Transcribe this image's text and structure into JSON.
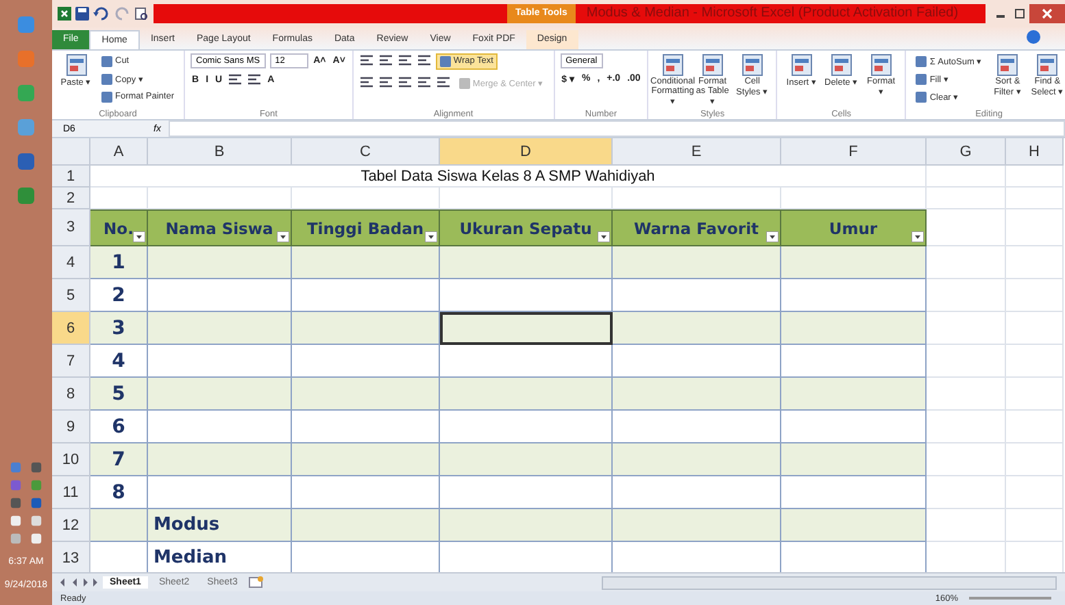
{
  "taskbar": {
    "time": "6:37 AM",
    "date": "9/24/2018"
  },
  "window": {
    "title": "Modus & Median  -  Microsoft Excel (Product Activation Failed)",
    "context_tab": "Table Tools"
  },
  "tabs": [
    {
      "label": "File",
      "kind": "file",
      "selected": false
    },
    {
      "label": "Home",
      "kind": "tab",
      "selected": true
    },
    {
      "label": "Insert",
      "kind": "tab",
      "selected": false
    },
    {
      "label": "Page Layout",
      "kind": "tab",
      "selected": false
    },
    {
      "label": "Formulas",
      "kind": "tab",
      "selected": false
    },
    {
      "label": "Data",
      "kind": "tab",
      "selected": false
    },
    {
      "label": "Review",
      "kind": "tab",
      "selected": false
    },
    {
      "label": "View",
      "kind": "tab",
      "selected": false
    },
    {
      "label": "Foxit PDF",
      "kind": "tab",
      "selected": false
    },
    {
      "label": "Design",
      "kind": "context",
      "selected": false
    }
  ],
  "ribbon": [
    {
      "name": "Clipboard",
      "lines": [
        [
          {
            "kind": "large",
            "label": "Paste ▾"
          }
        ],
        [
          {
            "kind": "small",
            "label": "Cut"
          },
          {
            "kind": "small",
            "label": "Copy ▾"
          },
          {
            "kind": "small",
            "label": "Format Painter"
          }
        ]
      ]
    },
    {
      "name": "Font",
      "lines": [
        [
          {
            "kind": "field",
            "label": "Comic Sans MS"
          },
          {
            "kind": "field",
            "label": "12"
          },
          {
            "kind": "glyph",
            "label": "A˄"
          },
          {
            "kind": "glyph",
            "label": "A˅"
          }
        ],
        [
          {
            "kind": "glyph",
            "label": "B"
          },
          {
            "kind": "glyph",
            "label": "I"
          },
          {
            "kind": "glyph",
            "label": "U"
          },
          {
            "kind": "icon"
          },
          {
            "kind": "icon"
          },
          {
            "kind": "glyph",
            "label": "A"
          }
        ]
      ]
    },
    {
      "name": "Alignment",
      "lines": [
        [
          {
            "kind": "icon"
          },
          {
            "kind": "icon"
          },
          {
            "kind": "icon"
          },
          {
            "kind": "icon"
          },
          {
            "kind": "small",
            "label": "Wrap Text",
            "on": true
          }
        ],
        [
          {
            "kind": "icon"
          },
          {
            "kind": "icon"
          },
          {
            "kind": "icon"
          },
          {
            "kind": "icon"
          },
          {
            "kind": "icon"
          },
          {
            "kind": "small",
            "label": "Merge & Center ▾",
            "disabled": true
          }
        ]
      ]
    },
    {
      "name": "Number",
      "lines": [
        [
          {
            "kind": "field",
            "label": "General"
          }
        ],
        [
          {
            "kind": "glyph",
            "label": "$ ▾"
          },
          {
            "kind": "glyph",
            "label": "%"
          },
          {
            "kind": "glyph",
            "label": ","
          },
          {
            "kind": "glyph",
            "label": "+.0"
          },
          {
            "kind": "glyph",
            "label": ".00"
          }
        ]
      ]
    },
    {
      "name": "Styles",
      "lines": [
        [
          {
            "kind": "large",
            "label": "Conditional Formatting ▾"
          }
        ],
        [
          {
            "kind": "large",
            "label": "Format as Table ▾"
          }
        ],
        [
          {
            "kind": "large",
            "label": "Cell Styles ▾"
          }
        ]
      ]
    },
    {
      "name": "Cells",
      "lines": [
        [
          {
            "kind": "large",
            "label": "Insert ▾"
          }
        ],
        [
          {
            "kind": "large",
            "label": "Delete ▾"
          }
        ],
        [
          {
            "kind": "large",
            "label": "Format ▾"
          }
        ]
      ]
    },
    {
      "name": "Editing",
      "lines": [
        [
          {
            "kind": "small",
            "label": "Σ AutoSum ▾"
          },
          {
            "kind": "small",
            "label": "Fill ▾"
          },
          {
            "kind": "small",
            "label": "Clear ▾"
          }
        ],
        [
          {
            "kind": "large",
            "label": "Sort & Filter ▾"
          }
        ],
        [
          {
            "kind": "large",
            "label": "Find & Select ▾"
          }
        ]
      ]
    }
  ],
  "formula_bar": {
    "name_box": "D6",
    "fx": "fx"
  },
  "columns": [
    {
      "label": "A",
      "selected": false
    },
    {
      "label": "B",
      "selected": false
    },
    {
      "label": "C",
      "selected": false
    },
    {
      "label": "D",
      "selected": true
    },
    {
      "label": "E",
      "selected": false
    },
    {
      "label": "F",
      "selected": false
    },
    {
      "label": "G",
      "selected": false
    },
    {
      "label": "H",
      "selected": false
    }
  ],
  "rows": [
    {
      "label": "1",
      "kind": "title",
      "selected": false,
      "text": "Tabel Data Siswa Kelas 8 A SMP Wahidiyah"
    },
    {
      "label": "2",
      "kind": "blank",
      "selected": false
    },
    {
      "label": "3",
      "kind": "header",
      "selected": false,
      "headers": [
        "No.",
        "Nama Siswa",
        "Tinggi Badan",
        "Ukuran Sepatu",
        "Warna Favorit",
        "Umur"
      ]
    },
    {
      "label": "4",
      "kind": "data",
      "selected": false,
      "banded": true,
      "cells": {
        "A": "1"
      }
    },
    {
      "label": "5",
      "kind": "data",
      "selected": false,
      "banded": false,
      "cells": {
        "A": "2"
      }
    },
    {
      "label": "6",
      "kind": "data",
      "selected": true,
      "banded": true,
      "cells": {
        "A": "3"
      }
    },
    {
      "label": "7",
      "kind": "data",
      "selected": false,
      "banded": false,
      "cells": {
        "A": "4"
      }
    },
    {
      "label": "8",
      "kind": "data",
      "selected": false,
      "banded": true,
      "cells": {
        "A": "5"
      }
    },
    {
      "label": "9",
      "kind": "data",
      "selected": false,
      "banded": false,
      "cells": {
        "A": "6"
      }
    },
    {
      "label": "10",
      "kind": "data",
      "selected": false,
      "banded": true,
      "cells": {
        "A": "7"
      }
    },
    {
      "label": "11",
      "kind": "data",
      "selected": false,
      "banded": false,
      "cells": {
        "A": "8"
      }
    },
    {
      "label": "12",
      "kind": "data",
      "selected": false,
      "banded": true,
      "cells": {
        "B": "Modus"
      }
    },
    {
      "label": "13",
      "kind": "data",
      "selected": false,
      "banded": false,
      "cells": {
        "B": "Median"
      }
    }
  ],
  "sheets": [
    {
      "label": "Sheet1",
      "selected": true
    },
    {
      "label": "Sheet2",
      "selected": false
    },
    {
      "label": "Sheet3",
      "selected": false
    }
  ],
  "status_bar": {
    "text": "Ready",
    "zoom": "160%"
  }
}
